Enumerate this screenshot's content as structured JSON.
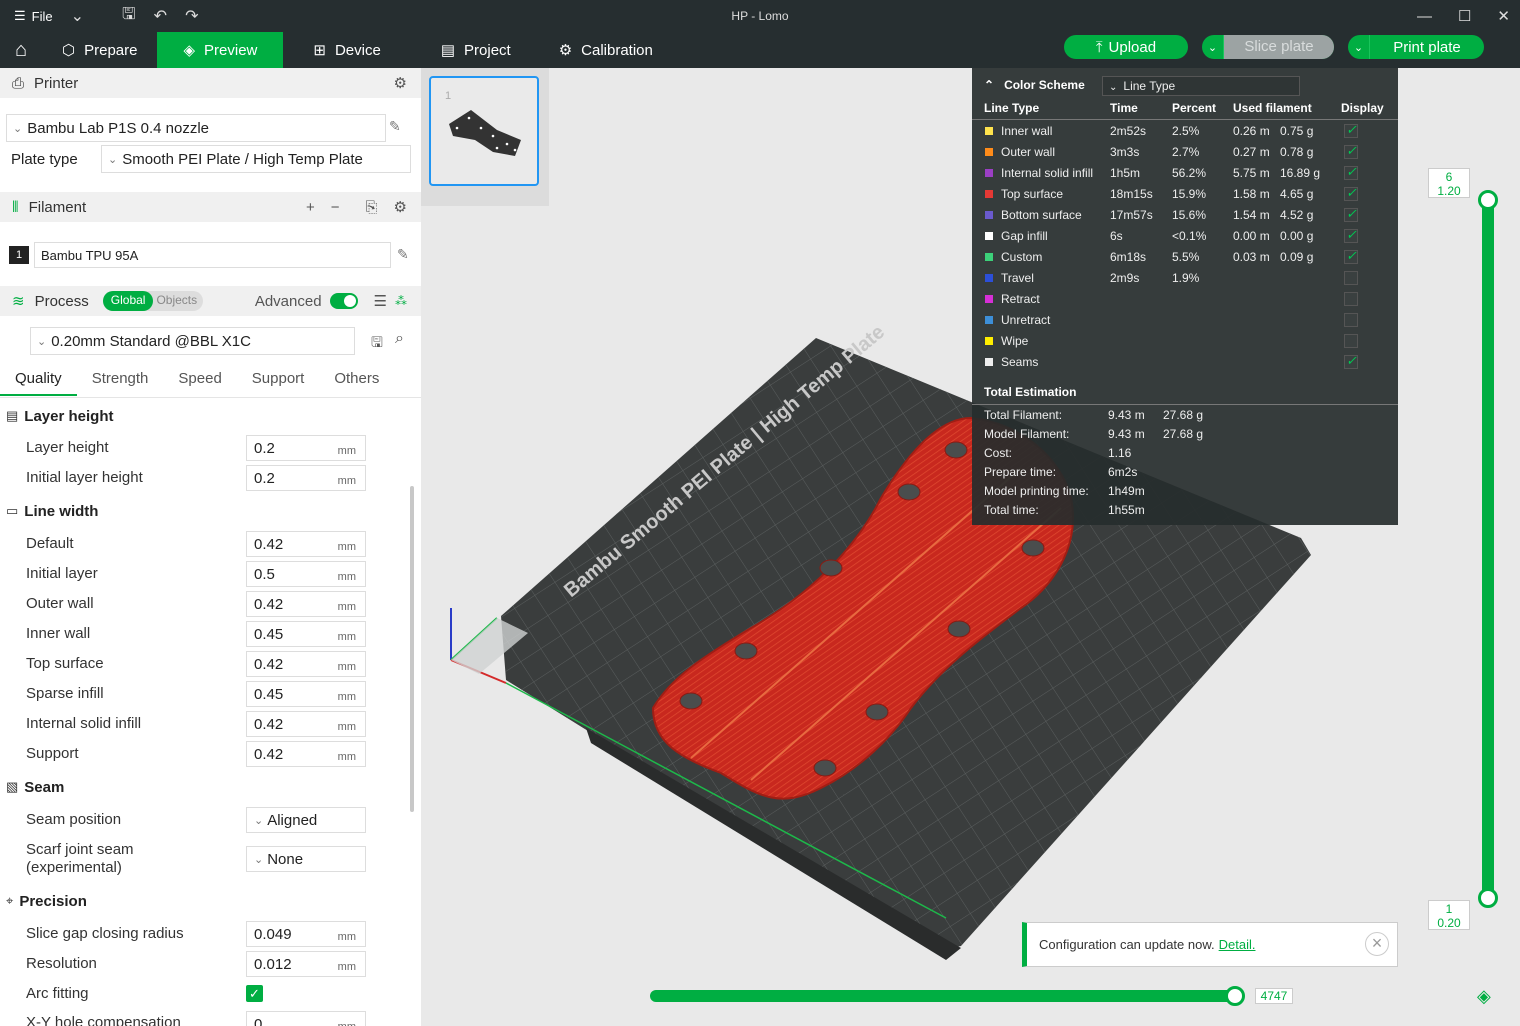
{
  "window": {
    "file_label": "File",
    "title": "HP - Lomo"
  },
  "nav": {
    "tabs": [
      {
        "label": "Prepare"
      },
      {
        "label": "Preview"
      },
      {
        "label": "Device"
      },
      {
        "label": "Project"
      },
      {
        "label": "Calibration"
      }
    ],
    "upload": "Upload",
    "slice": "Slice plate",
    "print": "Print plate"
  },
  "printer": {
    "header": "Printer",
    "name": "Bambu Lab P1S 0.4 nozzle",
    "plate_type_label": "Plate type",
    "plate_type": "Smooth PEI Plate / High Temp Plate"
  },
  "filament": {
    "header": "Filament",
    "slot": "1",
    "name": "Bambu TPU 95A"
  },
  "process": {
    "header": "Process",
    "global": "Global",
    "objects": "Objects",
    "advanced": "Advanced",
    "preset": "0.20mm Standard @BBL X1C"
  },
  "tabs": [
    "Quality",
    "Strength",
    "Speed",
    "Support",
    "Others"
  ],
  "groups": {
    "layer_height": "Layer height",
    "line_width": "Line width",
    "seam": "Seam",
    "precision": "Precision"
  },
  "settings": {
    "layer_height": [
      {
        "label": "Layer height",
        "value": "0.2",
        "unit": "mm"
      },
      {
        "label": "Initial layer height",
        "value": "0.2",
        "unit": "mm"
      }
    ],
    "line_width": [
      {
        "label": "Default",
        "value": "0.42",
        "unit": "mm"
      },
      {
        "label": "Initial layer",
        "value": "0.5",
        "unit": "mm"
      },
      {
        "label": "Outer wall",
        "value": "0.42",
        "unit": "mm"
      },
      {
        "label": "Inner wall",
        "value": "0.45",
        "unit": "mm"
      },
      {
        "label": "Top surface",
        "value": "0.42",
        "unit": "mm"
      },
      {
        "label": "Sparse infill",
        "value": "0.45",
        "unit": "mm"
      },
      {
        "label": "Internal solid infill",
        "value": "0.42",
        "unit": "mm"
      },
      {
        "label": "Support",
        "value": "0.42",
        "unit": "mm"
      }
    ],
    "seam": [
      {
        "label": "Seam position",
        "value": "Aligned"
      },
      {
        "label": "Scarf joint seam (experimental)",
        "value": "None"
      }
    ],
    "precision": [
      {
        "label": "Slice gap closing radius",
        "value": "0.049",
        "unit": "mm"
      },
      {
        "label": "Resolution",
        "value": "0.012",
        "unit": "mm"
      },
      {
        "label": "Arc fitting",
        "value": ""
      },
      {
        "label": "X-Y hole compensation",
        "value": "0",
        "unit": "mm"
      }
    ]
  },
  "plate_text": "Bambu Smooth PEI Plate | High Temp Plate",
  "color_scheme": {
    "title": "Color Scheme",
    "mode": "Line Type",
    "headers": {
      "type": "Line Type",
      "time": "Time",
      "percent": "Percent",
      "used": "Used filament",
      "display": "Display"
    },
    "rows": [
      {
        "name": "Inner wall",
        "color": "#ffe34d",
        "time": "2m52s",
        "percent": "2.5%",
        "len": "0.26 m",
        "wt": "0.75 g",
        "on": true
      },
      {
        "name": "Outer wall",
        "color": "#ff8c1a",
        "time": "3m3s",
        "percent": "2.7%",
        "len": "0.27 m",
        "wt": "0.78 g",
        "on": true
      },
      {
        "name": "Internal solid infill",
        "color": "#9b3fc4",
        "time": "1h5m",
        "percent": "56.2%",
        "len": "5.75 m",
        "wt": "16.89 g",
        "on": true
      },
      {
        "name": "Top surface",
        "color": "#e53935",
        "time": "18m15s",
        "percent": "15.9%",
        "len": "1.58 m",
        "wt": "4.65 g",
        "on": true
      },
      {
        "name": "Bottom surface",
        "color": "#6a5acd",
        "time": "17m57s",
        "percent": "15.6%",
        "len": "1.54 m",
        "wt": "4.52 g",
        "on": true
      },
      {
        "name": "Gap infill",
        "color": "#ffffff",
        "time": "6s",
        "percent": "<0.1%",
        "len": "0.00 m",
        "wt": "0.00 g",
        "on": true
      },
      {
        "name": "Custom",
        "color": "#3cd079",
        "time": "6m18s",
        "percent": "5.5%",
        "len": "0.03 m",
        "wt": "0.09 g",
        "on": true
      },
      {
        "name": "Travel",
        "color": "#2c4fd8",
        "time": "2m9s",
        "percent": "1.9%",
        "len": "",
        "wt": "",
        "on": false
      },
      {
        "name": "Retract",
        "color": "#d62fd6",
        "time": "",
        "percent": "",
        "len": "",
        "wt": "",
        "on": false
      },
      {
        "name": "Unretract",
        "color": "#3d8fd8",
        "time": "",
        "percent": "",
        "len": "",
        "wt": "",
        "on": false
      },
      {
        "name": "Wipe",
        "color": "#ffee00",
        "time": "",
        "percent": "",
        "len": "",
        "wt": "",
        "on": false
      },
      {
        "name": "Seams",
        "color": "#eeeeee",
        "time": "",
        "percent": "",
        "len": "",
        "wt": "",
        "on": true
      }
    ],
    "total_title": "Total Estimation",
    "totals": [
      {
        "label": "Total Filament:",
        "v1": "9.43 m",
        "v2": "27.68 g"
      },
      {
        "label": "Model Filament:",
        "v1": "9.43 m",
        "v2": "27.68 g"
      },
      {
        "label": "Cost:",
        "v1": "1.16",
        "v2": ""
      },
      {
        "label": "Prepare time:",
        "v1": "6m2s",
        "v2": ""
      },
      {
        "label": "Model printing time:",
        "v1": "1h49m",
        "v2": ""
      },
      {
        "label": "Total time:",
        "v1": "1h55m",
        "v2": ""
      }
    ]
  },
  "layer_slider": {
    "top_layer": "6",
    "top_height": "1.20",
    "bottom_layer": "1",
    "bottom_height": "0.20"
  },
  "move_slider": {
    "value": "4747"
  },
  "thumb": {
    "plate_number": "1"
  },
  "notification": {
    "text": "Configuration can update now.",
    "link": "Detail."
  }
}
